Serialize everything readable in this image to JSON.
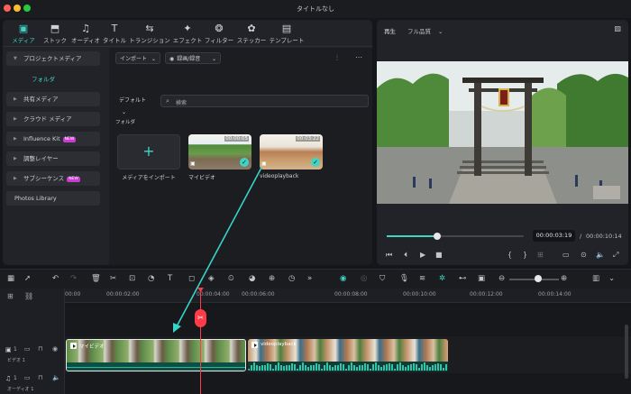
{
  "window": {
    "title": "タイトルなし"
  },
  "tabs": [
    {
      "label": "メディア",
      "icon": "media-icon",
      "glyph": "▣",
      "active": true
    },
    {
      "label": "ストック",
      "icon": "stock-icon",
      "glyph": "⬒"
    },
    {
      "label": "オーディオ",
      "icon": "music-icon",
      "glyph": "♫"
    },
    {
      "label": "タイトル",
      "icon": "title-icon",
      "glyph": "T"
    },
    {
      "label": "トランジション",
      "icon": "transition-icon",
      "glyph": "⇆"
    },
    {
      "label": "エフェクト",
      "icon": "effect-icon",
      "glyph": "✦"
    },
    {
      "label": "フィルター",
      "icon": "filter-icon",
      "glyph": "❂"
    },
    {
      "label": "ステッカー",
      "icon": "sticker-icon",
      "glyph": "✿"
    },
    {
      "label": "テンプレート",
      "icon": "template-icon",
      "glyph": "▤"
    }
  ],
  "sidebar": {
    "items": [
      {
        "label": "プロジェクトメディア",
        "expanded": true
      },
      {
        "label": "フォルダ",
        "sub": true
      },
      {
        "label": "共有メディア"
      },
      {
        "label": "クラウド メディア"
      },
      {
        "label": "Influence Kit",
        "badge": "NEW"
      },
      {
        "label": "調整レイヤー"
      },
      {
        "label": "サブシーケンス",
        "badge": "NEW"
      },
      {
        "label": "Photos Library",
        "plain": true
      }
    ]
  },
  "media": {
    "import_label": "インポート",
    "record_label": "録画/録音",
    "sort_label": "デフォルト",
    "search_placeholder": "検索",
    "folder_label": "フォルダ",
    "items": [
      {
        "caption": "メディアをインポート",
        "type": "import"
      },
      {
        "caption": "マイビデオ",
        "duration": "00:00:05",
        "checked": true
      },
      {
        "caption": "videoplayback",
        "duration": "00:03:22",
        "checked": true
      }
    ]
  },
  "player": {
    "play_label": "再生",
    "quality": "フル品質",
    "current_time": "00:00:03:19",
    "separator": "/",
    "total_time": "00:00:10:14",
    "progress": 0.37
  },
  "timeline": {
    "ticks": [
      "00:00",
      "00:00:02:00",
      "00:00:04:00",
      "00:00:06:00",
      "00:00:08:00",
      "00:00:10:00",
      "00:00:12:00",
      "00:00:14:00"
    ],
    "video_track_label": "ビデオ 1",
    "audio_track_label": "オーディオ 1",
    "video_track_num": "1",
    "audio_track_num": "1",
    "clips": [
      {
        "label": "マイビデオ",
        "selected": true
      },
      {
        "label": "videoplayback",
        "selected": false
      }
    ]
  },
  "colors": {
    "accent": "#3fd5c5",
    "playhead": "#ff3b4a",
    "badge": "#c93bd1"
  }
}
